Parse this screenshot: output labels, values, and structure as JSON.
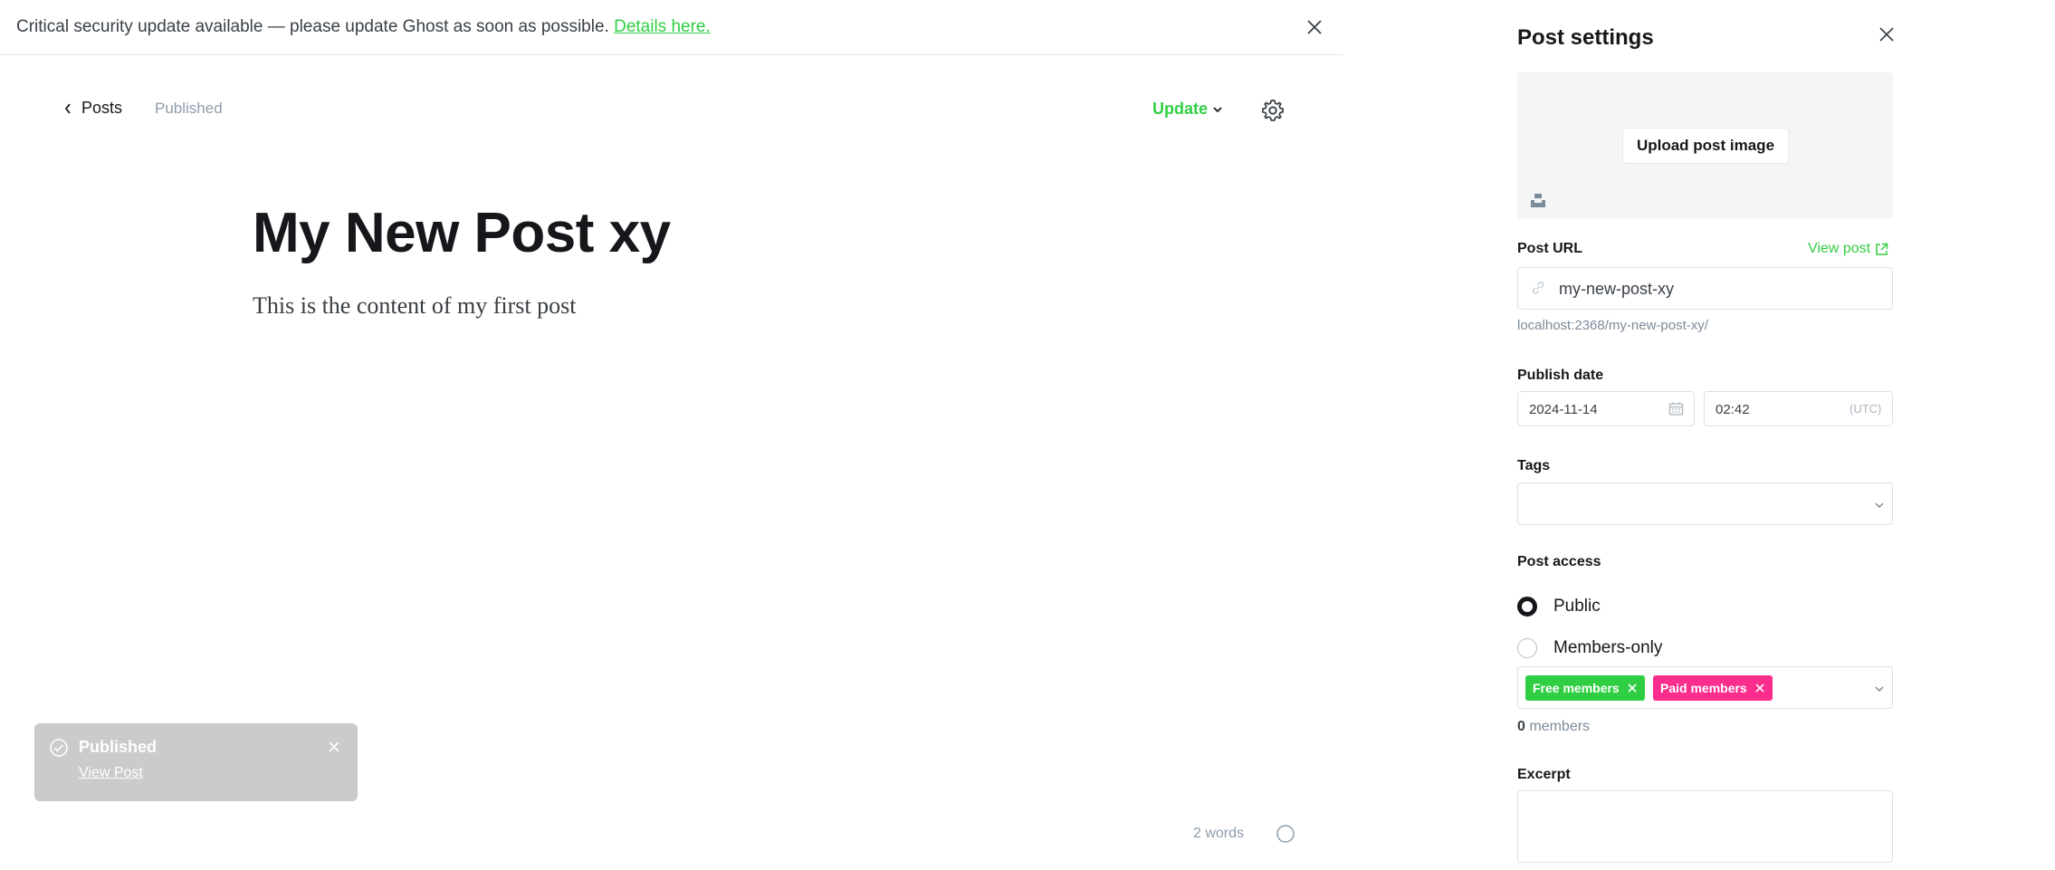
{
  "banner": {
    "message": "Critical security update available — please update Ghost as soon as possible.",
    "link": "Details here."
  },
  "editor": {
    "back_label": "Posts",
    "status": "Published",
    "update_label": "Update",
    "title": "My New Post xy",
    "body": "This is the content of my first post",
    "word_count": "2 words"
  },
  "toast": {
    "title": "Published",
    "link": "View Post"
  },
  "settings": {
    "title": "Post settings",
    "upload_label": "Upload post image",
    "post_url_label": "Post URL",
    "view_post_label": "View post",
    "slug": "my-new-post-xy",
    "url_preview": "localhost:2368/my-new-post-xy/",
    "publish_date_label": "Publish date",
    "date": "2024-11-14",
    "time": "02:42",
    "timezone": "(UTC)",
    "tags_label": "Tags",
    "access_label": "Post access",
    "access_options": [
      {
        "label": "Public",
        "selected": true
      },
      {
        "label": "Members-only",
        "selected": false
      }
    ],
    "tiers": [
      "Free members",
      "Paid members"
    ],
    "members_count": "0",
    "members_suffix": "members",
    "excerpt_label": "Excerpt"
  },
  "colors": {
    "accent": "#30cf43",
    "paid": "#fb2d8d",
    "toast_bg": "#cbcbcb"
  }
}
